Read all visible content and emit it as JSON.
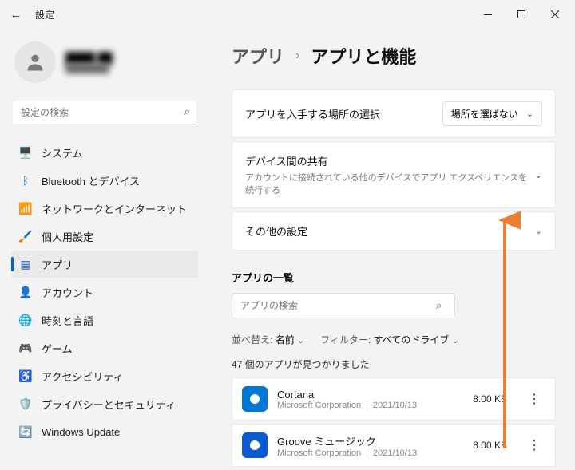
{
  "titlebar": {
    "title": "設定"
  },
  "profile": {
    "name": "████ ██",
    "email": "███████"
  },
  "search": {
    "placeholder": "設定の検索"
  },
  "sidebar": {
    "items": [
      {
        "label": "システム",
        "color": "#1e90ff",
        "glyph": "🖥️"
      },
      {
        "label": "Bluetooth とデバイス",
        "color": "#0078d4",
        "glyph": "ᛒ"
      },
      {
        "label": "ネットワークとインターネット",
        "color": "#00a2ed",
        "glyph": "📶"
      },
      {
        "label": "個人用設定",
        "color": "#c85f00",
        "glyph": "🖌️"
      },
      {
        "label": "アプリ",
        "color": "#3a6fb5",
        "glyph": "▦"
      },
      {
        "label": "アカウント",
        "color": "#3cb371",
        "glyph": "👤"
      },
      {
        "label": "時刻と言語",
        "color": "#4b6ea9",
        "glyph": "🌐"
      },
      {
        "label": "ゲーム",
        "color": "#777",
        "glyph": "🎮"
      },
      {
        "label": "アクセシビリティ",
        "color": "#2e86de",
        "glyph": "♿"
      },
      {
        "label": "プライバシーとセキュリティ",
        "color": "#6b7785",
        "glyph": "🛡️"
      },
      {
        "label": "Windows Update",
        "color": "#0078d4",
        "glyph": "🔄"
      }
    ]
  },
  "breadcrumb": {
    "parent": "アプリ",
    "sep": "›",
    "current": "アプリと機能"
  },
  "cards": {
    "source": {
      "title": "アプリを入手する場所の選択",
      "select_value": "場所を選ばない"
    },
    "sharing": {
      "title": "デバイス間の共有",
      "desc": "アカウントに接続されている他のデバイスでアプリ エクスペリエンスを続行する"
    },
    "other": {
      "title": "その他の設定"
    }
  },
  "applist": {
    "heading": "アプリの一覧",
    "search_placeholder": "アプリの検索",
    "sort_label": "並べ替え:",
    "sort_value": "名前",
    "filter_label": "フィルター:",
    "filter_value": "すべてのドライブ",
    "found": "47 個のアプリが見つかりました",
    "rows": [
      {
        "name": "Cortana",
        "publisher": "Microsoft Corporation",
        "date": "2021/10/13",
        "size": "8.00 KB"
      },
      {
        "name": "Groove ミュージック",
        "publisher": "Microsoft Corporation",
        "date": "2021/10/13",
        "size": "8.00 KB"
      }
    ]
  }
}
